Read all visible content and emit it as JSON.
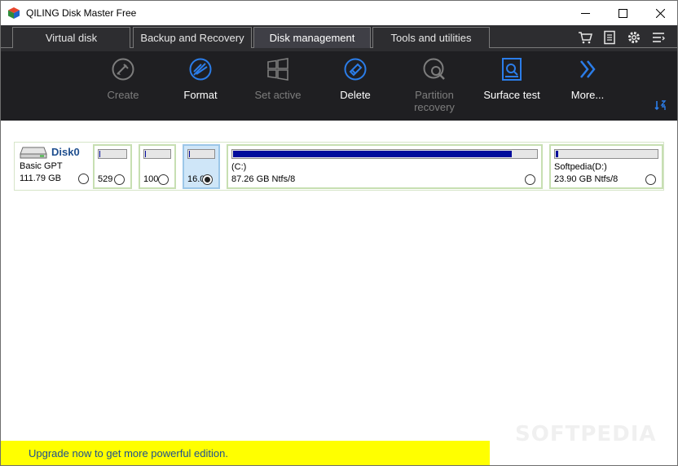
{
  "window": {
    "title": "QILING Disk Master Free",
    "minimize_icon": "minimize-icon",
    "maximize_icon": "maximize-icon",
    "close_icon": "close-icon"
  },
  "tabs": [
    {
      "label": "Virtual disk",
      "active": false
    },
    {
      "label": "Backup and Recovery",
      "active": false
    },
    {
      "label": "Disk management",
      "active": true
    },
    {
      "label": "Tools and utilities",
      "active": false
    }
  ],
  "top_icons": [
    "cart-icon",
    "document-icon",
    "gear-icon",
    "menu-icon"
  ],
  "toolbar": {
    "items": [
      {
        "label": "Create",
        "icon": "create-icon",
        "enabled": false
      },
      {
        "label": "Format",
        "icon": "format-icon",
        "enabled": true
      },
      {
        "label": "Set active",
        "icon": "set-active-icon",
        "enabled": false
      },
      {
        "label": "Delete",
        "icon": "delete-icon",
        "enabled": true
      },
      {
        "label": "Partition recovery",
        "icon": "partition-recovery-icon",
        "enabled": false
      },
      {
        "label": "Surface test",
        "icon": "surface-test-icon",
        "enabled": true
      },
      {
        "label": "More...",
        "icon": "more-icon",
        "enabled": true
      }
    ],
    "corner_icon": "sort-icon"
  },
  "disk": {
    "name": "Disk0",
    "type": "Basic GPT",
    "size": "111.79 GB",
    "partitions": [
      {
        "label": "",
        "size_text": "529",
        "used_fraction": 0.08,
        "selected": false
      },
      {
        "label": "",
        "size_text": "100",
        "used_fraction": 0.08,
        "selected": false
      },
      {
        "label": "",
        "size_text": "16.0",
        "used_fraction": 0.08,
        "selected": true
      },
      {
        "label": "(C:)",
        "size_text": "87.26 GB Ntfs/8",
        "used_fraction": 0.92,
        "selected": false
      },
      {
        "label": "Softpedia(D:)",
        "size_text": "23.90 GB Ntfs/8",
        "used_fraction": 0.04,
        "selected": false
      }
    ]
  },
  "upgrade": {
    "text": "Upgrade now to get more powerful edition."
  },
  "watermark": "SOFTPEDIA",
  "colors": {
    "accent": "#2b7de9",
    "ribbon": "#2d2d30",
    "toolbar": "#1f1f22",
    "bar_fill": "#000c9c",
    "banner": "#ffff00"
  }
}
